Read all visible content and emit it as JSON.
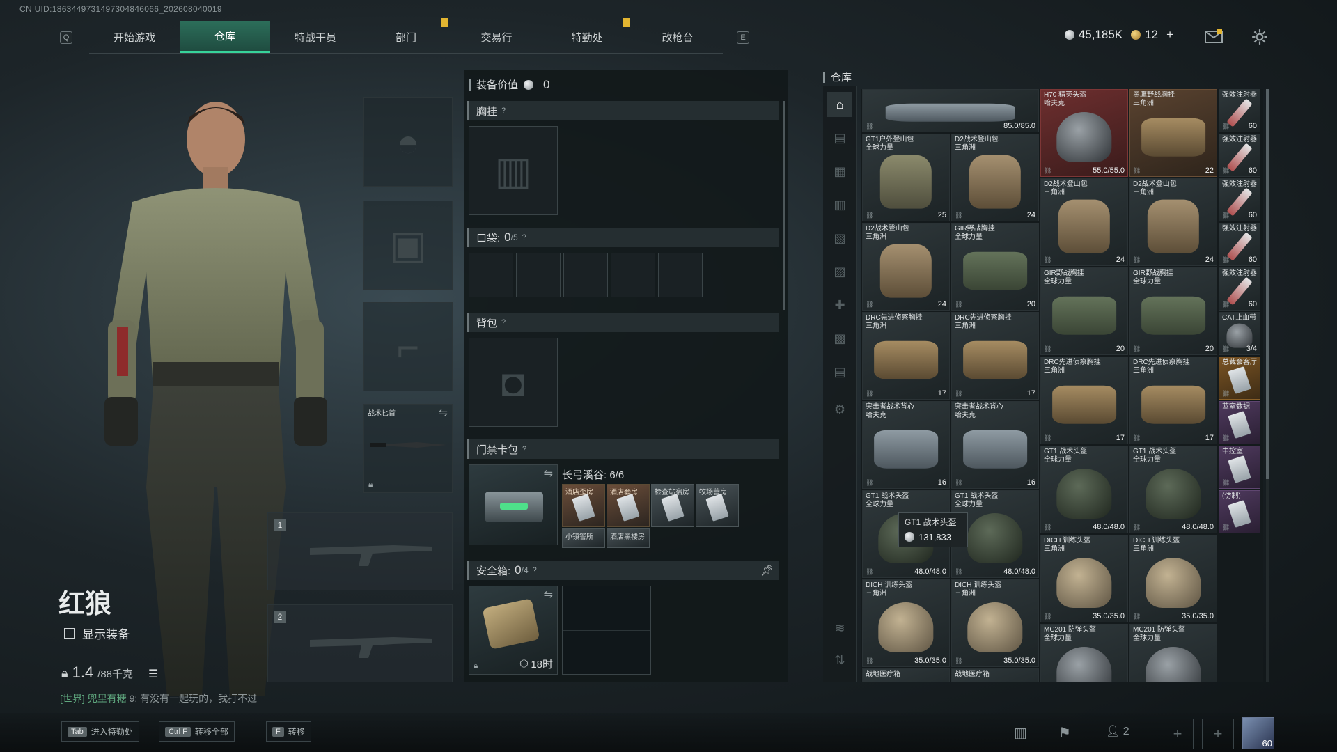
{
  "uid": "CN UID:1863449731497304846066_202608040019",
  "nav": {
    "key_left": "Q",
    "key_right": "E",
    "tabs": [
      "开始游戏",
      "仓库",
      "特战干员",
      "部门",
      "交易行",
      "特勤处",
      "改枪台"
    ],
    "active_tab": "仓库"
  },
  "currency": {
    "silver": "45,185K",
    "gold": "12",
    "plus": "+"
  },
  "operator": {
    "name": "红狼",
    "show_gear_label": "显示装备",
    "weight_value": "1.4",
    "weight_unit": "/88千克"
  },
  "chat": {
    "channel": "[世界]",
    "sender": "兜里有糖",
    "message": "9: 有没有一起玩的，我打不过"
  },
  "equipment": {
    "melee_label": "战术匕首",
    "weapon_slot_1": "1",
    "weapon_slot_2": "2"
  },
  "loadout": {
    "value_label": "装备价值",
    "value": "0",
    "chest_rig_label": "胸挂",
    "pockets_label": "口袋:",
    "pockets_count": "0",
    "pockets_total": "/5",
    "backpack_label": "背包",
    "keycard_label": "门禁卡包",
    "keycard_map": "长弓溪谷: 6/6",
    "keycards": [
      "酒店歪房",
      "酒店套房",
      "检查站宿房",
      "牧场营房",
      "小镇警所",
      "酒店黑楼房"
    ],
    "safebox_label": "安全箱:",
    "safebox_count": "0",
    "safebox_total": "/4",
    "safebox_timer": "18时",
    "help": "?"
  },
  "warehouse": {
    "title": "仓库",
    "tooltip_name": "GT1 战术头盔",
    "tooltip_value": "131,833",
    "items": [
      {
        "name": "",
        "count": "85.0/85.0",
        "color": "gray"
      },
      {
        "name": "H70 精英头盔\n哈夫克",
        "count": "55.0/55.0",
        "color": "red"
      },
      {
        "name": "黑鹰野战胸挂\n三角洲",
        "count": "22",
        "color": "brown"
      },
      {
        "name": "强效注射器",
        "count": "60",
        "color": "gray"
      },
      {
        "name": "GT1户外登山包\n全球力量",
        "count": "25",
        "color": "gray"
      },
      {
        "name": "D2战术登山包\n三角洲",
        "count": "24",
        "color": "gray"
      },
      {
        "name": "强效注射器",
        "count": "60",
        "color": "gray"
      },
      {
        "name": "D2战术登山包\n三角洲",
        "count": "24",
        "color": "gray"
      },
      {
        "name": "D2战术登山包\n三角洲",
        "count": "24",
        "color": "gray"
      },
      {
        "name": "强效注射器",
        "count": "60",
        "color": "gray"
      },
      {
        "name": "D2战术登山包\n三角洲",
        "count": "24",
        "color": "gray"
      },
      {
        "name": "GIR野战胸挂\n全球力量",
        "count": "20",
        "color": "gray"
      },
      {
        "name": "强效注射器",
        "count": "60",
        "color": "gray"
      },
      {
        "name": "GIR野战胸挂\n全球力量",
        "count": "20",
        "color": "gray"
      },
      {
        "name": "GIR野战胸挂\n全球力量",
        "count": "20",
        "color": "gray"
      },
      {
        "name": "强效注射器",
        "count": "60",
        "color": "gray"
      },
      {
        "name": "DRC先进侦察胸挂\n三角洲",
        "count": "17",
        "color": "gray"
      },
      {
        "name": "DRC先进侦察胸挂\n三角洲",
        "count": "17",
        "color": "gray"
      },
      {
        "name": "CAT止血带",
        "count": "3/4",
        "color": "gray"
      },
      {
        "name": "DRC先进侦察胸挂\n三角洲",
        "count": "17",
        "color": "gray"
      },
      {
        "name": "DRC先进侦察胸挂\n三角洲",
        "count": "17",
        "color": "gray"
      },
      {
        "name": "总裁会客厅",
        "count": "",
        "color": "orange"
      },
      {
        "name": "突击者战术背心\n哈夫克",
        "count": "16",
        "color": "gray"
      },
      {
        "name": "突击者战术背心\n哈夫克",
        "count": "16",
        "color": "gray"
      },
      {
        "name": "蓝室数据",
        "count": "",
        "color": "purple"
      },
      {
        "name": "GT1 战术头盔\n全球力量",
        "count": "48.0/48.0",
        "color": "gray"
      },
      {
        "name": "GT1 战术头盔\n全球力量",
        "count": "48.0/48.0",
        "color": "gray"
      },
      {
        "name": "中控室",
        "count": "",
        "color": "purple"
      },
      {
        "name": "GT1 战术头盔\n全球力量",
        "count": "48.0/48.0",
        "color": "gray"
      },
      {
        "name": "GT1 战术头盔\n全球力量",
        "count": "48.0/48.0",
        "color": "gray"
      },
      {
        "name": "DICH 训练头盔\n三角洲",
        "count": "35.0/35.0",
        "color": "gray"
      },
      {
        "name": "DICH 训练头盔\n三角洲",
        "count": "35.0/35.0",
        "color": "gray"
      },
      {
        "name": "(仿制)",
        "count": "",
        "color": "purple"
      },
      {
        "name": "DICH 训练头盔\n三角洲",
        "count": "35.0/35.0",
        "color": "gray"
      },
      {
        "name": "DICH 训练头盔\n三角洲",
        "count": "35.0/35.0",
        "color": "gray"
      },
      {
        "name": "MC201 防弹头盔\n全球力量",
        "count": "",
        "color": "gray"
      },
      {
        "name": "MC201 防弹头盔\n全球力量",
        "count": "",
        "color": "gray"
      },
      {
        "name": "战地医疗箱",
        "count": "",
        "color": "gray"
      },
      {
        "name": "战地医疗箱",
        "count": "",
        "color": "gray"
      }
    ]
  },
  "hotkeys": [
    {
      "key": "Tab",
      "label": "进入特勤处"
    },
    {
      "key": "Ctrl F",
      "label": "转移全部"
    },
    {
      "key": "F",
      "label": "转移"
    }
  ],
  "bottom_right": {
    "friends_count": "2",
    "level": "60"
  }
}
